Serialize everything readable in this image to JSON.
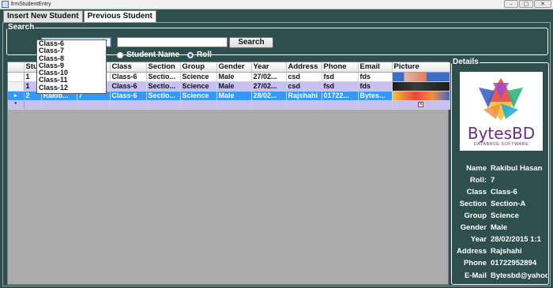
{
  "window": {
    "title": "frmStudentEntry",
    "min": "–",
    "max": "□",
    "close": "✕"
  },
  "tabs": [
    {
      "label": "Insert New Student"
    },
    {
      "label": "Previous Student"
    }
  ],
  "search": {
    "legend": "Search",
    "class_value": "",
    "name_value": "",
    "button": "Search",
    "radio_name": "Student Name",
    "radio_roll": "Roll",
    "class_options": [
      "Class-6",
      "Class-7",
      "Class-8",
      "Class-9",
      "Class-10",
      "Class-11",
      "Class-12"
    ]
  },
  "grid": {
    "headers": [
      "Stu",
      "",
      "oll",
      "Class",
      "Section",
      "Group",
      "Gender",
      "Year",
      "Address",
      "Phone",
      "Email",
      "Picture"
    ],
    "rows": [
      {
        "id": "1",
        "name": "",
        "roll": "",
        "class": "Class-6",
        "section": "Sectio...",
        "group": "Science",
        "gender": "Male",
        "year": "27/02...",
        "address": "csd",
        "phone": "fsd",
        "email": "fds"
      },
      {
        "id": "1",
        "name": "",
        "roll": "",
        "class": "Class-6",
        "section": "Sectio...",
        "group": "Science",
        "gender": "Male",
        "year": "27/02...",
        "address": "csd",
        "phone": "fsd",
        "email": "fds"
      },
      {
        "id": "2",
        "name": "Rakib...",
        "roll": "7",
        "class": "Class-6",
        "section": "Sectio...",
        "group": "Science",
        "gender": "Male",
        "year": "28/02...",
        "address": "Rajshahi",
        "phone": "01722...",
        "email": "Bytes..."
      }
    ],
    "new_row_marker": "*",
    "current_row_marker": "▸"
  },
  "details": {
    "legend": "Details",
    "logo": {
      "name": "BytesBD",
      "tagline": "DATABASE SOFTWARE"
    },
    "fields": [
      {
        "label": "Name",
        "value": "Rakibul Hasan"
      },
      {
        "label": "Roll:",
        "value": "7"
      },
      {
        "label": "Class",
        "value": "Class-6"
      },
      {
        "label": "Section",
        "value": "Section-A"
      },
      {
        "label": "Group",
        "value": "Science"
      },
      {
        "label": "Gender",
        "value": "Male"
      },
      {
        "label": "Year",
        "value": "28/02/2015 1:1"
      },
      {
        "label": "Address",
        "value": "Rajshahi"
      },
      {
        "label": "Phone",
        "value": "01722952894"
      },
      {
        "label": "E-Mail",
        "value": "Bytesbd@yahoo."
      }
    ]
  },
  "colors": {
    "background": "#2f4f4f",
    "selection": "#3399ff",
    "row_alt": "#c8c0f0"
  }
}
